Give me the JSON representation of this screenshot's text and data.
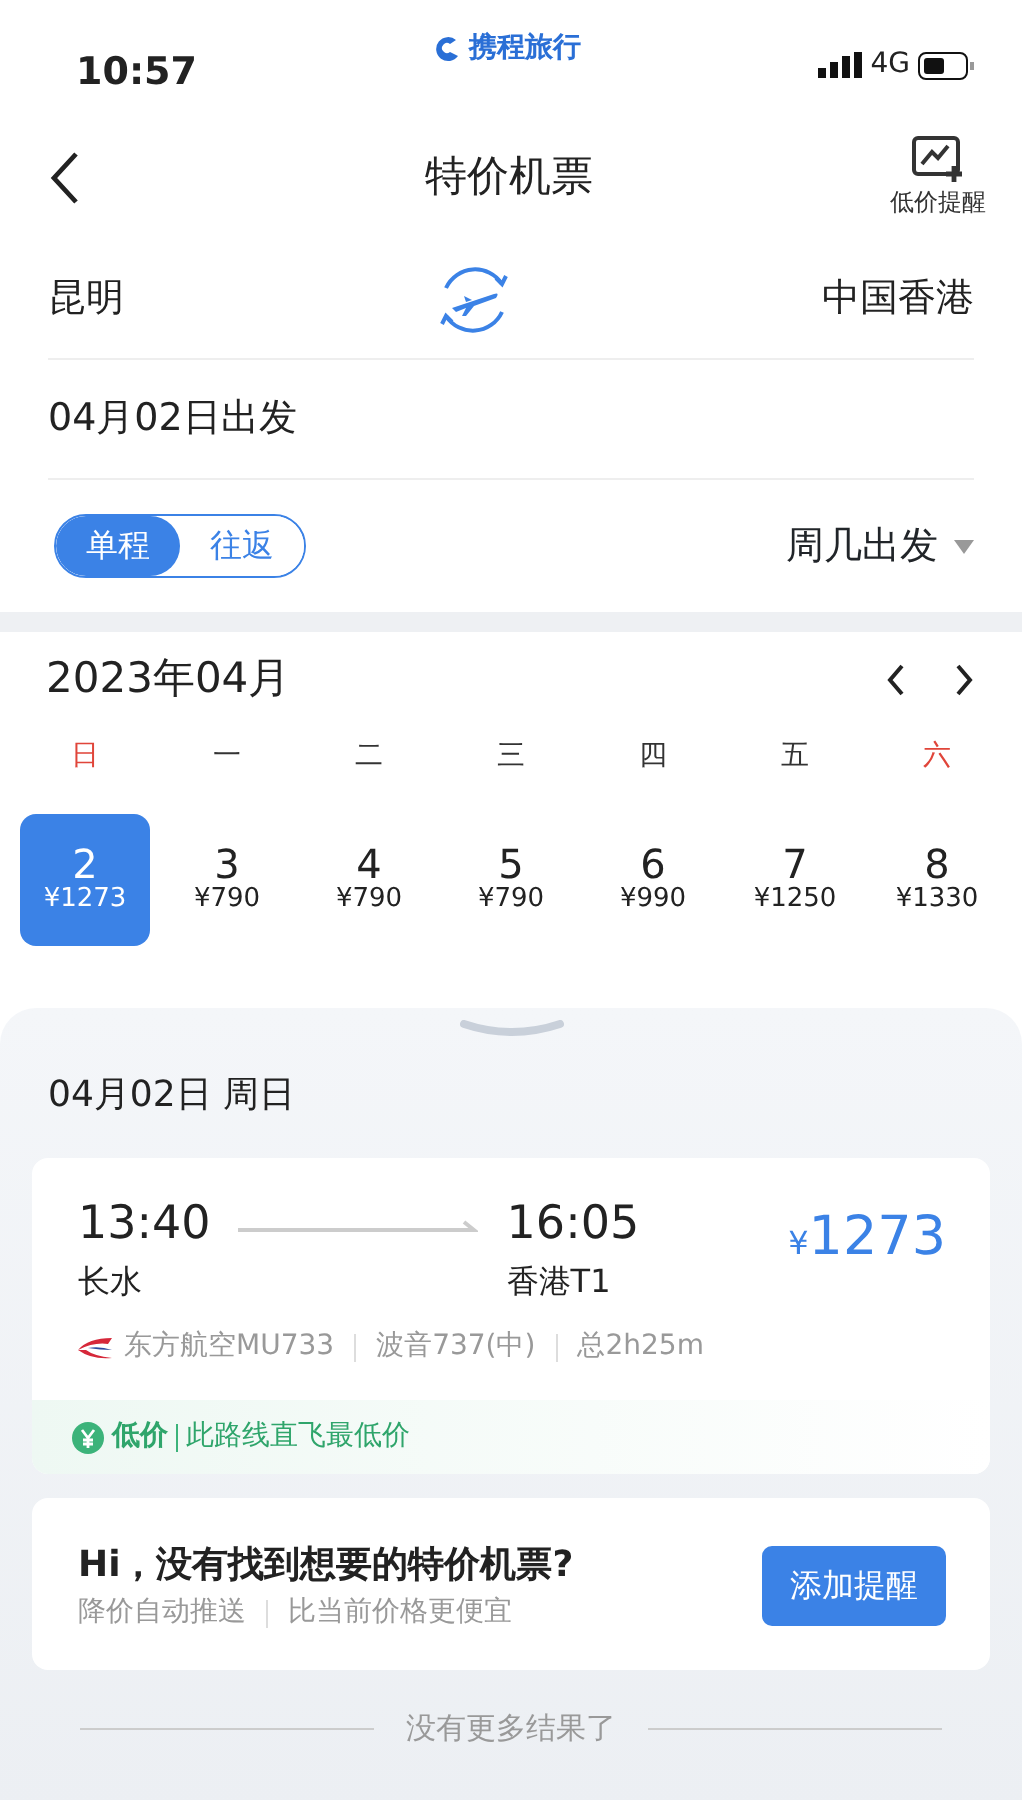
{
  "status_bar": {
    "time": "10:57",
    "logo_text": "携程旅行",
    "network": "4G"
  },
  "nav": {
    "title": "特价机票",
    "alert_label": "低价提醒"
  },
  "route": {
    "from": "昆明",
    "to": "中国香港"
  },
  "departure": "04月02日出发",
  "trip_types": [
    {
      "label": "单程",
      "selected": true
    },
    {
      "label": "往返",
      "selected": false
    }
  ],
  "weekday_filter": "周几出发",
  "calendar": {
    "month": "2023年04月",
    "weekdays": [
      {
        "label": "日",
        "weekend": true
      },
      {
        "label": "一",
        "weekend": false
      },
      {
        "label": "二",
        "weekend": false
      },
      {
        "label": "三",
        "weekend": false
      },
      {
        "label": "四",
        "weekend": false
      },
      {
        "label": "五",
        "weekend": false
      },
      {
        "label": "六",
        "weekend": true
      }
    ],
    "days": [
      {
        "day": "2",
        "price": "¥1273",
        "selected": true
      },
      {
        "day": "3",
        "price": "¥790",
        "selected": false
      },
      {
        "day": "4",
        "price": "¥790",
        "selected": false
      },
      {
        "day": "5",
        "price": "¥790",
        "selected": false
      },
      {
        "day": "6",
        "price": "¥990",
        "selected": false
      },
      {
        "day": "7",
        "price": "¥1250",
        "selected": false
      },
      {
        "day": "8",
        "price": "¥1330",
        "selected": false
      }
    ]
  },
  "results": {
    "date_heading": "04月02日 周日",
    "flights": [
      {
        "depart_time": "13:40",
        "depart_airport": "长水",
        "arrive_time": "16:05",
        "arrive_airport": "香港T1",
        "currency": "¥",
        "price": "1273",
        "airline": "东方航空MU733",
        "aircraft": "波音737(中)",
        "duration": "总2h25m",
        "tag": "低价",
        "tag_note": "此路线直飞最低价"
      }
    ],
    "promo": {
      "title": "Hi，没有找到想要的特价机票?",
      "notes": [
        "降价自动推送",
        "比当前价格更便宜"
      ],
      "button": "添加提醒"
    },
    "end_text": "没有更多结果了"
  }
}
